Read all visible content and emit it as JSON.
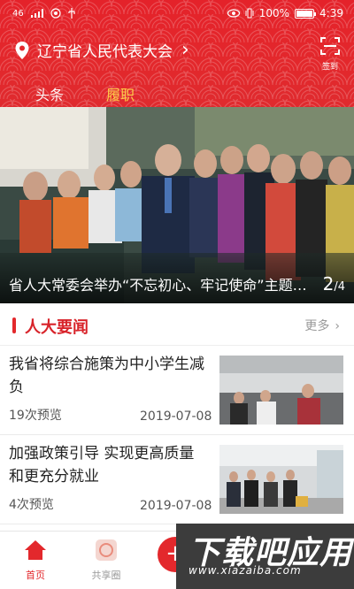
{
  "statusbar": {
    "signal": "46",
    "battery_pct": "100%",
    "time": "4:39"
  },
  "header": {
    "location": "辽宁省人民代表大会",
    "sign_label": "签到",
    "tabs": [
      {
        "label": "头条",
        "active": true
      },
      {
        "label": "履职",
        "active": false
      }
    ],
    "accent_color": "#e3282c"
  },
  "banner": {
    "caption": "省人大常委会举办“不忘初心、牢记使命”主题教育",
    "page_current": "2",
    "page_total": "/4"
  },
  "section": {
    "title": "人大要闻",
    "more_label": "更多",
    "news": [
      {
        "title": "我省将综合施策为中小学生减负",
        "views": "19次预览",
        "date": "2019-07-08"
      },
      {
        "title": "加强政策引导 实现更高质量和更充分就业",
        "views": "4次预览",
        "date": "2019-07-08"
      }
    ]
  },
  "bottomnav": {
    "home_label": "首页",
    "share_label": "共享圈",
    "fab_icon": "add-icon"
  },
  "watermark": {
    "big": "下载吧应用",
    "small": "www.xiazaiba.com"
  }
}
